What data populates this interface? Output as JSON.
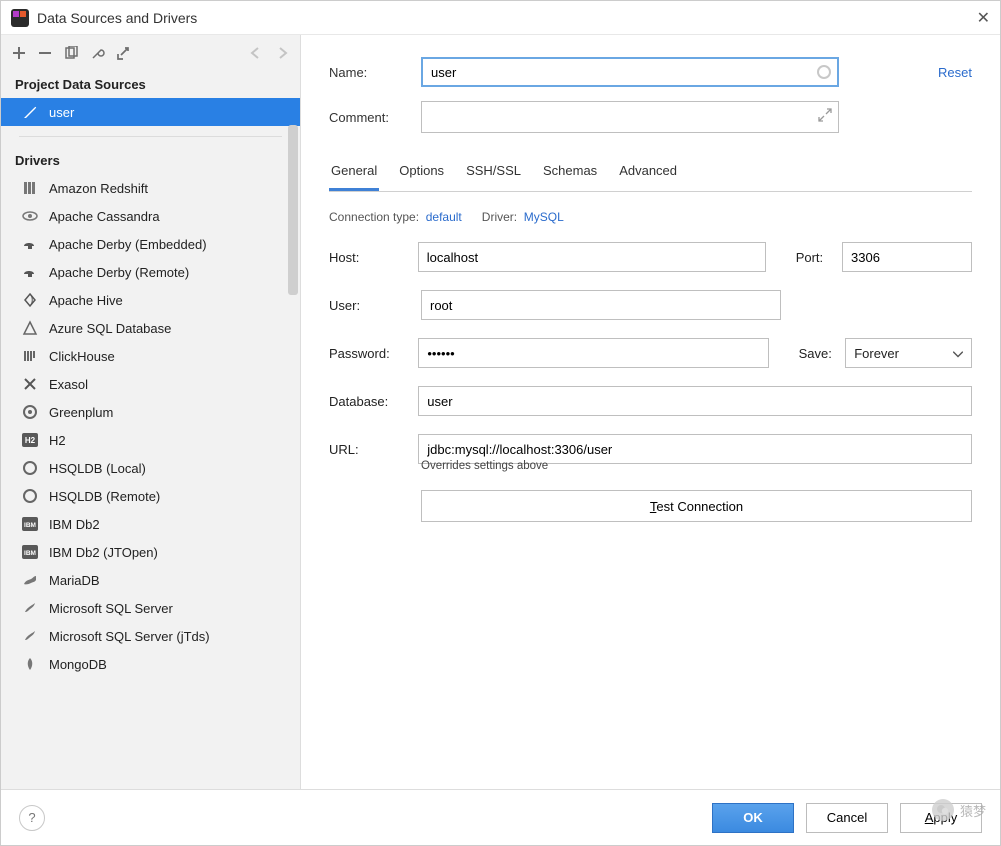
{
  "window": {
    "title": "Data Sources and Drivers"
  },
  "toolbar": {
    "icons": [
      "plus",
      "minus",
      "copy",
      "wrench",
      "import",
      "back",
      "forward"
    ]
  },
  "sidebar": {
    "project_label": "Project Data Sources",
    "drivers_label": "Drivers",
    "data_sources": [
      {
        "label": "user",
        "icon": "feather",
        "selected": true
      }
    ],
    "drivers": [
      {
        "label": "Amazon Redshift",
        "icon": "redshift"
      },
      {
        "label": "Apache Cassandra",
        "icon": "eye"
      },
      {
        "label": "Apache Derby (Embedded)",
        "icon": "derby"
      },
      {
        "label": "Apache Derby (Remote)",
        "icon": "derby"
      },
      {
        "label": "Apache Hive",
        "icon": "hive"
      },
      {
        "label": "Azure SQL Database",
        "icon": "azure"
      },
      {
        "label": "ClickHouse",
        "icon": "clickhouse"
      },
      {
        "label": "Exasol",
        "icon": "x"
      },
      {
        "label": "Greenplum",
        "icon": "green"
      },
      {
        "label": "H2",
        "icon": "h2"
      },
      {
        "label": "HSQLDB (Local)",
        "icon": "circle"
      },
      {
        "label": "HSQLDB (Remote)",
        "icon": "circle"
      },
      {
        "label": "IBM Db2",
        "icon": "ibm"
      },
      {
        "label": "IBM Db2 (JTOpen)",
        "icon": "ibm"
      },
      {
        "label": "MariaDB",
        "icon": "mariadb"
      },
      {
        "label": "Microsoft SQL Server",
        "icon": "mssql"
      },
      {
        "label": "Microsoft SQL Server (jTds)",
        "icon": "mssql"
      },
      {
        "label": "MongoDB",
        "icon": "mongo"
      }
    ]
  },
  "panel": {
    "name_label": "Name:",
    "name_value": "user",
    "reset_label": "Reset",
    "comment_label": "Comment:",
    "tabs": [
      "General",
      "Options",
      "SSH/SSL",
      "Schemas",
      "Advanced"
    ],
    "active_tab": 0,
    "conn_type_label": "Connection type:",
    "conn_type_value": "default",
    "driver_label": "Driver:",
    "driver_value": "MySQL",
    "host_label": "Host:",
    "host_value": "localhost",
    "port_label": "Port:",
    "port_value": "3306",
    "user_label": "User:",
    "user_value": "root",
    "password_label": "Password:",
    "password_value": "••••••",
    "save_label": "Save:",
    "save_value": "Forever",
    "database_label": "Database:",
    "database_value": "user",
    "url_label": "URL:",
    "url_value": "jdbc:mysql://localhost:3306/user",
    "url_hint": "Overrides settings above",
    "test_btn_prefix": "T",
    "test_btn_rest": "est Connection"
  },
  "footer": {
    "ok": "OK",
    "cancel": "Cancel",
    "apply_prefix": "A",
    "apply_rest": "pply"
  },
  "watermark": {
    "text": "猿梦"
  }
}
